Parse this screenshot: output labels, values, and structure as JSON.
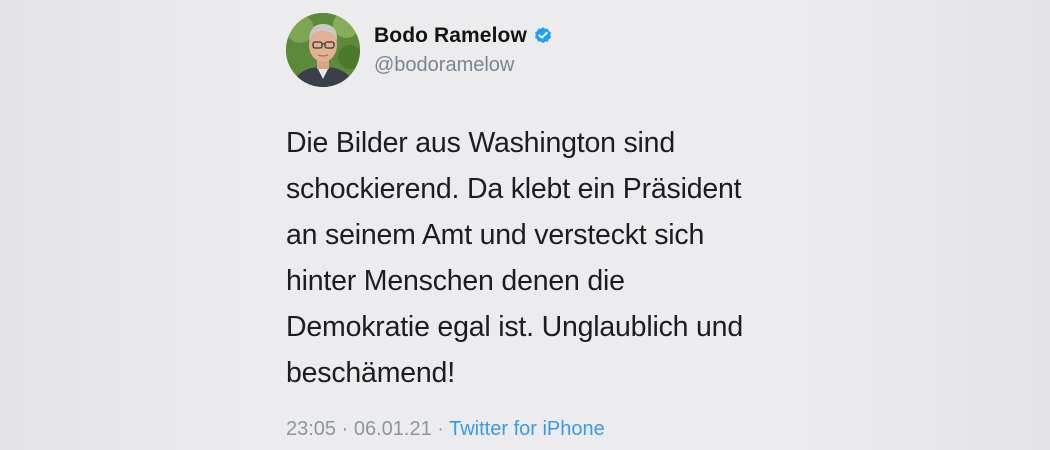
{
  "author": {
    "display_name": "Bodo Ramelow",
    "handle": "@bodoramelow",
    "verified": true,
    "avatar_icon": "profile-photo"
  },
  "tweet": {
    "text": "Die Bilder aus Washington sind\nschockierend. Da klebt ein Präsident\nan seinem Amt und versteckt sich\nhinter Menschen denen die\nDemokratie egal ist. Unglaublich und\nbeschämend!",
    "time": "23:05",
    "separator": " · ",
    "date": "06.01.21",
    "source": "Twitter for iPhone"
  },
  "colors": {
    "background": "#ececee",
    "verified_badge": "#1da1f2",
    "source_link": "#3a9ae8",
    "secondary_text": "#7b8690"
  }
}
